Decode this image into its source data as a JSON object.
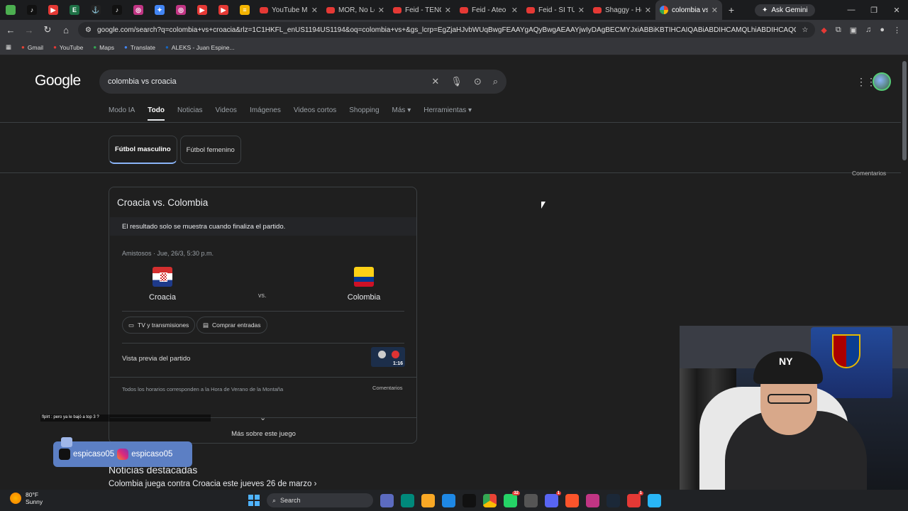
{
  "browser": {
    "tabs_mini": [
      {
        "icon": "chrome-icon",
        "color": "#4caf50",
        "glyph": ""
      },
      {
        "icon": "tiktok-icon",
        "color": "#111111",
        "glyph": "♪"
      },
      {
        "icon": "youtube-icon",
        "color": "#e53935",
        "glyph": "▶"
      },
      {
        "icon": "excel-icon",
        "color": "#1e7145",
        "glyph": "E"
      },
      {
        "icon": "anchor-icon",
        "color": "#222222",
        "glyph": "⚓"
      },
      {
        "icon": "tiktok-icon",
        "color": "#111111",
        "glyph": "♪"
      },
      {
        "icon": "instagram-icon",
        "color": "#c13584",
        "glyph": "◎"
      },
      {
        "icon": "gemini-icon",
        "color": "#4285f4",
        "glyph": "✦"
      },
      {
        "icon": "instagram-icon",
        "color": "#c13584",
        "glyph": "◎"
      },
      {
        "icon": "youtube-icon",
        "color": "#e53935",
        "glyph": "▶"
      },
      {
        "icon": "youtube-icon",
        "color": "#e53935",
        "glyph": "▶"
      },
      {
        "icon": "notes-icon",
        "color": "#f4b400",
        "glyph": "≡"
      }
    ],
    "tabs": [
      {
        "title": "YouTube Mus",
        "icon": "youtube-music-icon"
      },
      {
        "title": "MOR, No Le",
        "icon": "youtube-music-icon"
      },
      {
        "title": "Feid - TENGO",
        "icon": "youtube-icon"
      },
      {
        "title": "Feid - Ateo -",
        "icon": "youtube-icon"
      },
      {
        "title": "Feid - SI TÚ S",
        "icon": "youtube-icon"
      },
      {
        "title": "Shaggy - Hey",
        "icon": "youtube-icon"
      },
      {
        "title": "colombia vs c",
        "icon": "google-icon",
        "active": true
      }
    ],
    "new_tab": "+",
    "ask_gemini": "Ask Gemini",
    "url": "google.com/search?q=colombia+vs+croacia&rlz=1C1HKFL_enUS1194US1194&oq=colombia+vs+&gs_lcrp=EgZjaHJvbWUqBwgFEAAYgAQyBwgAEAAYjwIyDAgBECMYJxiABBiKBTIHCAIQABiABDIHCAMQLhiABDIHCAQQABiABDIHC...",
    "bookmarks": [
      {
        "label": "Gmail",
        "icon": "gmail-icon"
      },
      {
        "label": "YouTube",
        "icon": "youtube-icon"
      },
      {
        "label": "Maps",
        "icon": "maps-icon"
      },
      {
        "label": "Translate",
        "icon": "translate-icon"
      },
      {
        "label": "ALEKS - Juan Espine...",
        "icon": "aleks-icon"
      }
    ]
  },
  "google": {
    "logo": "Google",
    "query": "colombia vs croacia",
    "filters": [
      "Modo IA",
      "Todo",
      "Noticias",
      "Videos",
      "Imágenes",
      "Videos cortos",
      "Shopping",
      "Más ▾",
      "Herramientas ▾"
    ],
    "active_filter": "Todo",
    "sport_tabs": [
      "Fútbol masculino",
      "Fútbol femenino"
    ],
    "comentarios": "Comentarios"
  },
  "match": {
    "title": "Croacia vs. Colombia",
    "notice": "El resultado solo se muestra cuando finaliza el partido.",
    "meta": "Amistosos · Jue, 26/3, 5:30 p.m.",
    "home": "Croacia",
    "away": "Colombia",
    "vs": "vs.",
    "tv": "TV y transmisiones",
    "tickets": "Comprar entradas",
    "preview": "Vista previa del partido",
    "preview_duration": "1:16",
    "timezone_note": "Todos los horarios corresponden a la Hora de Verano de la Montaña",
    "comentarios": "Comentarios",
    "more": "Más sobre este juego"
  },
  "news": {
    "heading": "Noticias destacadas",
    "link": "Colombia juega contra Croacia este jueves 26 de marzo"
  },
  "overlay": {
    "chat_line": "flplrt : pero ya le bajó a top 3 ?",
    "tiktok_handle": "espicaso05",
    "instagram_handle": "espicaso05"
  },
  "taskbar": {
    "temp": "80°F",
    "condition": "Sunny",
    "search": "Search",
    "badges": {
      "whatsapp": "32",
      "discord": "1",
      "app": "1"
    }
  }
}
